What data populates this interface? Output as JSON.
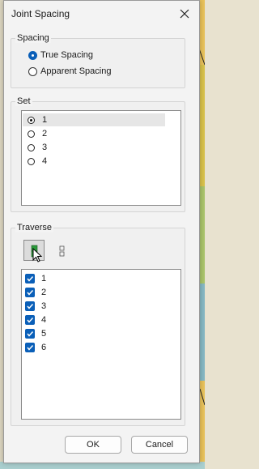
{
  "window": {
    "title": "Joint Spacing"
  },
  "spacing": {
    "label": "Spacing",
    "options": [
      {
        "label": "True Spacing",
        "selected": true
      },
      {
        "label": "Apparent Spacing",
        "selected": false
      }
    ]
  },
  "set": {
    "label": "Set",
    "items": [
      {
        "label": "1",
        "selected": true
      },
      {
        "label": "2",
        "selected": false
      },
      {
        "label": "3",
        "selected": false
      },
      {
        "label": "4",
        "selected": false
      }
    ]
  },
  "traverse": {
    "label": "Traverse",
    "items": [
      {
        "label": "1",
        "checked": true
      },
      {
        "label": "2",
        "checked": true
      },
      {
        "label": "3",
        "checked": true
      },
      {
        "label": "4",
        "checked": true
      },
      {
        "label": "5",
        "checked": true
      },
      {
        "label": "6",
        "checked": true
      }
    ]
  },
  "buttons": {
    "ok": "OK",
    "cancel": "Cancel"
  },
  "colors": {
    "accent": "#0a5fb8",
    "dialog_bg": "#f3f3f3"
  }
}
